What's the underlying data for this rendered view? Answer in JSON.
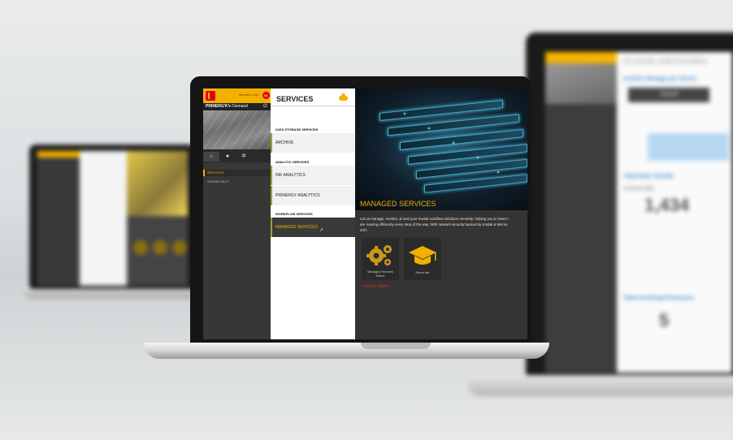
{
  "left_laptop": {},
  "right_laptop": {
    "title": "CLOUD ARCHIVING",
    "section1": "Archive Storage per Server",
    "tab": "Overall",
    "section2": "Total Data Transfer",
    "archived_label": "Archived (GB)",
    "archived_value": "1,434",
    "section3": "Total Archiving Processes",
    "processes_value": "5"
  },
  "main": {
    "nav": {
      "user_name": "Michael Lowe",
      "user_badge": "ML",
      "brand_name": "PRINERGY",
      "brand_sub": "On Demand",
      "items": [
        {
          "label": "SERVICES"
        },
        {
          "label": "ONLINE HELP"
        }
      ]
    },
    "services": {
      "title": "SERVICES",
      "sections": [
        {
          "heading": "DATA STORAGE SERVICES",
          "items": [
            "ARCHIVE"
          ]
        },
        {
          "heading": "ANALYTIC SERVICES",
          "items": [
            "INK ANALYTICS",
            "PRINERGY ANALYTICS"
          ]
        },
        {
          "heading": "WORKFLOW SERVICES",
          "items": [
            "MANAGED SERVICES"
          ]
        }
      ]
    },
    "content": {
      "title": "MANAGED SERVICES",
      "desc": [
        "Let us manage, monitor, & host your Kodak workflow solutions remotely, helping you to lower t",
        "are running efficiently every step of the way. With network security backed by Kodak & Micros",
        "24/7."
      ],
      "tiles": [
        {
          "label_1": "Managed Services",
          "label_2": "Status",
          "icon": "gears-icon"
        },
        {
          "label_1": "Demo link",
          "label_2": "",
          "icon": "graduation-cap-icon"
        }
      ],
      "coming_soon": "COMING SOON..."
    }
  }
}
